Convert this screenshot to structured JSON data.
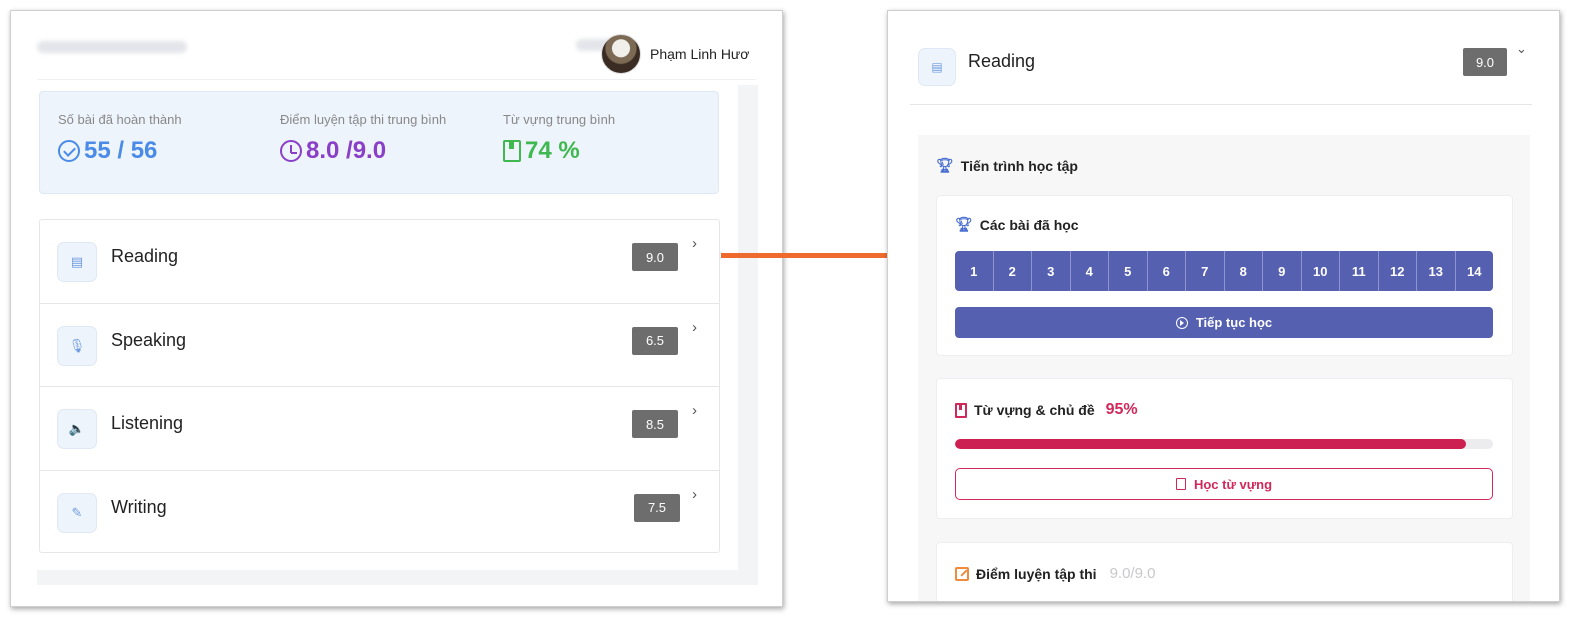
{
  "user": {
    "name": "Phạm Linh Hươ"
  },
  "stats": [
    {
      "label": "Số bài đã hoàn thành",
      "value": "55 / 56",
      "icon": "check-circle-icon",
      "color": "#4a8be8"
    },
    {
      "label": "Điểm luyện tập thi trung bình",
      "value": "8.0 /9.0",
      "icon": "clock-icon",
      "color": "#8a3fc7"
    },
    {
      "label": "Từ vựng trung bình",
      "value": "74 %",
      "icon": "book-icon",
      "color": "#3fb84f"
    }
  ],
  "skills": [
    {
      "name": "Reading",
      "score": "9.0",
      "icon": "book-open-icon"
    },
    {
      "name": "Speaking",
      "score": "6.5",
      "icon": "microphone-icon"
    },
    {
      "name": "Listening",
      "score": "8.5",
      "icon": "speaker-icon"
    },
    {
      "name": "Writing",
      "score": "7.5",
      "icon": "pen-icon"
    }
  ],
  "detail": {
    "title": "Reading",
    "score": "9.0",
    "progress_section_title": "Tiến trình học tập",
    "lessons_title": "Các bài đã học",
    "lessons": [
      "1",
      "2",
      "3",
      "4",
      "5",
      "6",
      "7",
      "8",
      "9",
      "10",
      "11",
      "12",
      "13",
      "14"
    ],
    "continue_label": "Tiếp tục học",
    "vocab_title": "Từ vựng & chủ đề",
    "vocab_percent": "95%",
    "vocab_progress": 0.95,
    "vocab_button": "Học từ vựng",
    "exam_title": "Điểm luyện tập thi",
    "exam_score": "9.0/9.0"
  },
  "colors": {
    "accent_blue": "#4a8be8",
    "accent_purple": "#8a3fc7",
    "accent_green": "#3fb84f",
    "lesson_bg": "#5560b0",
    "vocab_red": "#d0285a",
    "arrow_orange": "#ee6b2d"
  }
}
